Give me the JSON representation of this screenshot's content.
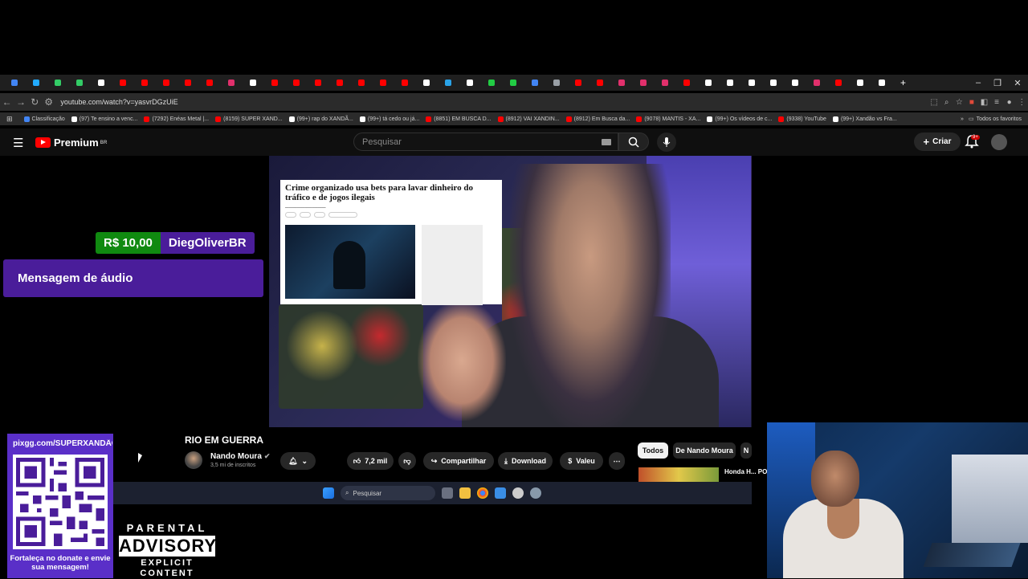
{
  "browser": {
    "url": "youtube.com/watch?v=yasvrDGzUiE",
    "bookmarks": [
      {
        "label": "Classificação",
        "color": "#4285f4"
      },
      {
        "label": "(97) Te ensino a venc...",
        "color": "#ffffff"
      },
      {
        "label": "(7292) Enéas Metal |...",
        "color": "#ff0000"
      },
      {
        "label": "(8159) SUPER XAND...",
        "color": "#ff0000"
      },
      {
        "label": "(99+) rap do XANDÃ...",
        "color": "#ffffff"
      },
      {
        "label": "(99+) tá cedo ou já...",
        "color": "#ffffff"
      },
      {
        "label": "(8851) EM BUSCA D...",
        "color": "#ff0000"
      },
      {
        "label": "(8912) VAI XANDIN...",
        "color": "#ff0000"
      },
      {
        "label": "(8912) Em Busca da...",
        "color": "#ff0000"
      },
      {
        "label": "(9078) MANTIS - XA...",
        "color": "#ff0000"
      },
      {
        "label": "(99+) Os vídeos de c...",
        "color": "#ffffff"
      },
      {
        "label": "(9338) YouTube",
        "color": "#ff0000"
      },
      {
        "label": "(99+) Xandão vs Fra...",
        "color": "#ffffff"
      }
    ],
    "all_favorites": "Todos os favoritos",
    "tab_colors": [
      "#4285f4",
      "#22aaff",
      "#33cc66",
      "#33cc66",
      "#ffffff",
      "#ff0000",
      "#ff0000",
      "#ff0000",
      "#ff0000",
      "#ff0000",
      "#e1306c",
      "#ffffff",
      "#ff0000",
      "#ff0000",
      "#ff0000",
      "#ff0000",
      "#ff0000",
      "#ff0000",
      "#ff0000",
      "#ffffff",
      "#2aa3e8",
      "#ffffff",
      "#22cc44",
      "#22cc44",
      "#4285f4",
      "#9aa0a6",
      "#ff0000",
      "#ff0000",
      "#e1306c",
      "#e1306c",
      "#e1306c",
      "#ff0000",
      "#ffffff",
      "#ffffff",
      "#ffffff",
      "#ffffff",
      "#ffffff",
      "#e1306c",
      "#ff0000",
      "#ffffff",
      "#ffffff"
    ]
  },
  "youtube": {
    "brand": "Premium",
    "region": "BR",
    "search_placeholder": "Pesquisar",
    "create_label": "Criar",
    "notification_count": "9+"
  },
  "video": {
    "article_headline": "Crime organizado usa bets para lavar dinheiro do tráfico e de jogos ilegais",
    "title": "RIO EM GUERRA",
    "channel": "Nando Moura",
    "subscribers": "3,5 mi de inscritos",
    "likes": "7,2 mil",
    "share_label": "Compartilhar",
    "download_label": "Download",
    "thanks_label": "Valeu"
  },
  "chips": [
    "Todos",
    "De Nando Moura",
    "N"
  ],
  "recommendation": {
    "title": "Honda H... POR QU..."
  },
  "overlays": {
    "donation_amount": "R$ 10,00",
    "donation_name": "DiegOliverBR",
    "audio_message": "Mensagem de áudio",
    "pix_url": "pixgg.com/SUPERXANDÃO",
    "pix_caption": "Fortaleça no donate e envie sua mensagem!",
    "pa_top": "PARENTAL",
    "pa_mid": "ADVISORY",
    "pa_bot": "EXPLICIT CONTENT"
  },
  "taskbar": {
    "search_placeholder": "Pesquisar"
  }
}
